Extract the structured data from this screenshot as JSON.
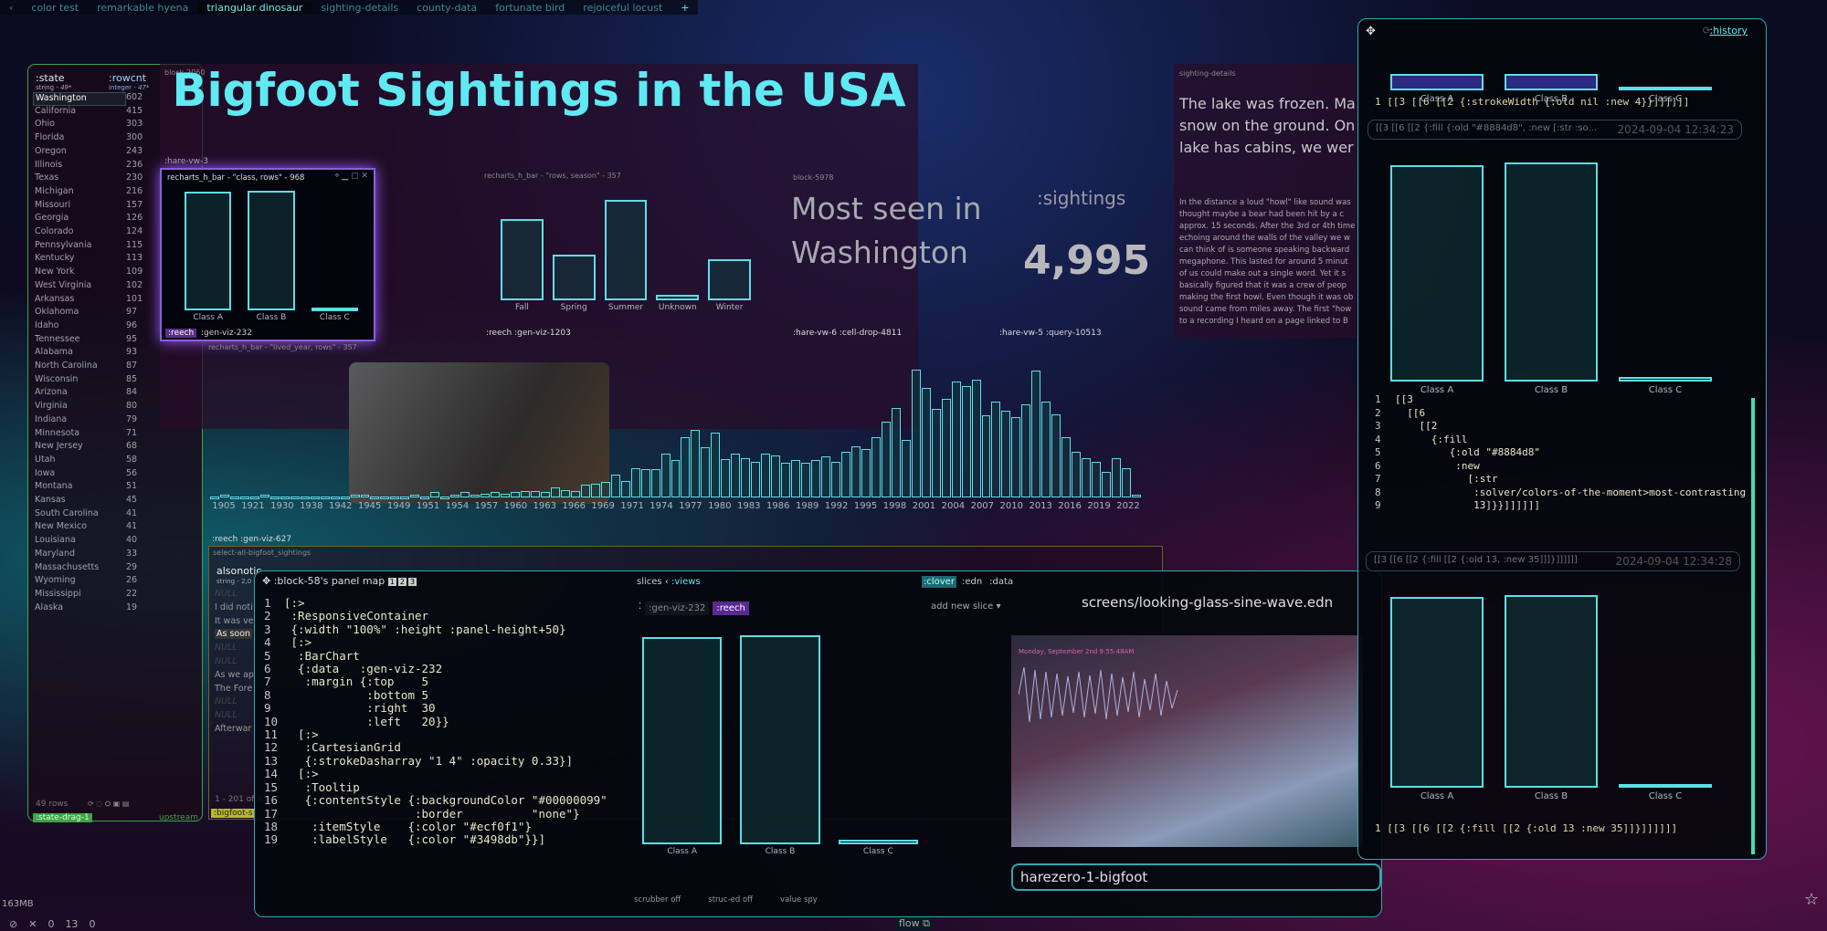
{
  "tabs": {
    "back": "‹",
    "items": [
      "color test",
      "remarkable hyena",
      "triangular dinosaur",
      "sighting-details",
      "county-data",
      "fortunate bird",
      "rejoiceful locust"
    ],
    "active": 2,
    "add": "+"
  },
  "state_table": {
    "columns": [
      {
        "name": ":state",
        "type": "string - ",
        "count": "49*"
      },
      {
        "name": ":rowcnt",
        "type": "integer - ",
        "count": "47*"
      }
    ],
    "rows": [
      [
        "Washington",
        "602"
      ],
      [
        "California",
        "415"
      ],
      [
        "Ohio",
        "303"
      ],
      [
        "Florida",
        "300"
      ],
      [
        "Oregon",
        "243"
      ],
      [
        "Illinois",
        "236"
      ],
      [
        "Texas",
        "230"
      ],
      [
        "Michigan",
        "216"
      ],
      [
        "Missouri",
        "157"
      ],
      [
        "Georgia",
        "126"
      ],
      [
        "Colorado",
        "124"
      ],
      [
        "Pennsylvania",
        "115"
      ],
      [
        "Kentucky",
        "113"
      ],
      [
        "New York",
        "109"
      ],
      [
        "West Virginia",
        "102"
      ],
      [
        "Arkansas",
        "101"
      ],
      [
        "Oklahoma",
        "97"
      ],
      [
        "Idaho",
        "96"
      ],
      [
        "Tennessee",
        "95"
      ],
      [
        "Alabama",
        "93"
      ],
      [
        "North Carolina",
        "87"
      ],
      [
        "Wisconsin",
        "85"
      ],
      [
        "Arizona",
        "84"
      ],
      [
        "Virginia",
        "80"
      ],
      [
        "Indiana",
        "79"
      ],
      [
        "Minnesota",
        "71"
      ],
      [
        "New Jersey",
        "68"
      ],
      [
        "Utah",
        "58"
      ],
      [
        "Iowa",
        "56"
      ],
      [
        "Montana",
        "51"
      ],
      [
        "Kansas",
        "45"
      ],
      [
        "South Carolina",
        "41"
      ],
      [
        "New Mexico",
        "41"
      ],
      [
        "Louisiana",
        "40"
      ],
      [
        "Maryland",
        "33"
      ],
      [
        "Massachusetts",
        "29"
      ],
      [
        "Wyoming",
        "26"
      ],
      [
        "Mississippi",
        "22"
      ],
      [
        "Alaska",
        "19"
      ]
    ],
    "selected": 0,
    "footer": "49 rows",
    "tag": ":state-drag-1",
    "upstream": "upstream"
  },
  "dashboard": {
    "block": "block-2060",
    "title": "Bigfoot Sightings in the USA",
    "hare3": ":hare-vw-3",
    "class_window": {
      "title": "recharts_h_bar - \"class, rows\" - 968",
      "tag1": ":reech",
      "tag2": ":gen-viz-232"
    },
    "season_label": "recharts_h_bar - \"rows, season\" - 357",
    "season_tag1": ":reech",
    "season_tag2": ":gen-viz-1203",
    "block5978": "block-5978",
    "most_seen": "Most seen in Washington",
    "sightings_label": ":sightings",
    "sightings_value": "4,995",
    "hare6": ":hare-vw-6",
    "cell_drop": ":cell-drop-4811",
    "hare5": ":hare-vw-5",
    "query": ":query-10513",
    "hist_label": "recharts_h_bar - \"lived_year, rows\" - 357",
    "hist_tag1": ":reech",
    "hist_tag2": ":gen-viz-627"
  },
  "details": {
    "label": "sighting-details",
    "headline": "The lake was frozen. Ma\nsnow on the ground. On\nlake has cabins, we wer",
    "body": "In the distance a loud \"howl\" like sound was\nthought maybe a bear had been hit by a c\napprox. 15 seconds. After the 3rd or 4th time\nechoing around the walls of the valley we w\ncan think of is someone speaking backward\nmegaphone. This lasted for around 5 minut\nof us could make out a single word. Yet it s\nbasically figured that it was a crew of peop\nmaking the first howl. Even though it was ob\nsound came from miles away. The first \"how\nto a recording I heard on a page linked to B"
  },
  "sightings_table": {
    "label": "select-all-bigfoot_sightings",
    "column": "alsonotic",
    "type": "string - 2,0",
    "rows": [
      "NULL",
      "I did noti",
      "It was ve",
      "As soon",
      "NULL",
      "NULL",
      "As we ap",
      "The Fore",
      "NULL",
      "NULL",
      "Afterwar"
    ],
    "selected": 3,
    "footer": "1 - 201 of 4",
    "tag": ":bigfoot-s"
  },
  "chart_data": [
    {
      "type": "bar",
      "title": "recharts_h_bar - \"class, rows\" - 968",
      "categories": [
        "Class A",
        "Class B",
        "Class C"
      ],
      "values": [
        87,
        88,
        2
      ]
    },
    {
      "type": "bar",
      "title": "recharts_h_bar - \"rows, season\" - 357",
      "categories": [
        "Fall",
        "Spring",
        "Summer",
        "Unknown",
        "Winter"
      ],
      "values": [
        69,
        39,
        85,
        5,
        35
      ]
    },
    {
      "type": "bar",
      "title": "recharts_h_bar - \"lived_year, rows\" - 357",
      "tick_labels": [
        "1905",
        "1921",
        "1930",
        "1938",
        "1942",
        "1945",
        "1949",
        "1951",
        "1954",
        "1957",
        "1960",
        "1963",
        "1966",
        "1969",
        "1971",
        "1974",
        "1977",
        "1980",
        "1983",
        "1986",
        "1989",
        "1992",
        "1995",
        "1998",
        "2001",
        "2004",
        "2007",
        "2010",
        "2013",
        "2016",
        "2019",
        "2022"
      ],
      "values": [
        1,
        2,
        1,
        1,
        1,
        2,
        1,
        1,
        1,
        1,
        1,
        1,
        1,
        1,
        2,
        2,
        1,
        1,
        1,
        1,
        2,
        1,
        4,
        1,
        2,
        4,
        2,
        3,
        4,
        3,
        4,
        5,
        5,
        4,
        8,
        6,
        5,
        10,
        11,
        12,
        18,
        13,
        23,
        22,
        22,
        34,
        29,
        47,
        53,
        39,
        51,
        30,
        34,
        31,
        28,
        34,
        33,
        27,
        29,
        27,
        29,
        32,
        28,
        36,
        40,
        38,
        47,
        59,
        70,
        45,
        100,
        86,
        69,
        77,
        91,
        87,
        92,
        64,
        75,
        68,
        63,
        73,
        99,
        75,
        65,
        47,
        36,
        31,
        28,
        20,
        31,
        23,
        2
      ]
    },
    {
      "type": "bar",
      "categories": [
        "Class A",
        "Class B",
        "Class C"
      ],
      "values": [
        95,
        96,
        2
      ]
    }
  ],
  "panel_map": {
    "title": ":block-58's panel map",
    "badges": [
      "1",
      "2",
      "3"
    ],
    "lines": [
      "[:>",
      " :ResponsiveContainer",
      " {:width \"100%\" :height :panel-height+50}",
      " [:>",
      "  :BarChart",
      "  {:data   :gen-viz-232",
      "   :margin {:top    5",
      "            :bottom 5",
      "            :right  30",
      "            :left   20}}",
      "  [:>",
      "   :CartesianGrid",
      "   {:strokeDasharray \"1 4\" :opacity 0.33}]",
      "  [:>",
      "   :Tooltip",
      "   {:contentStyle {:backgroundColor \"#00000099\"",
      "                   :border          \"none\"}",
      "    :itemStyle    {:color \"#ecf0f1\"}",
      "    :labelStyle   {:color \"#3498db\"}}]"
    ]
  },
  "slices": {
    "label": "slices",
    "back": "‹",
    "views": ":views",
    "modes": [
      ":clover",
      ":edn",
      ":data"
    ],
    "chip1": ":gen-viz-232",
    "chip2": ":reech",
    "add": "add new slice",
    "add_caret": "▾",
    "footer": [
      "scrubber off",
      "struc-ed off",
      "value spy"
    ]
  },
  "screen": {
    "file": "screens/looking-glass-sine-wave.edn",
    "caption": "Monday, September 2nd 9:55:48AM",
    "input": "harezero-1-bigfoot"
  },
  "history": {
    "link": ":history",
    "top_line": "1 [[3 [[6 [[2 {:strokeWidth {:old nil :new 4}}]]]]]]",
    "entry1": {
      "summary": "[[3 [[6 [[2 {:fill {:old \"#8884d8\", :new [:str :so...",
      "time": "2024-09-04 12:34:23"
    },
    "code": [
      "[[3",
      "  [[6",
      "    [[2",
      "      {:fill",
      "         {:old \"#8884d8\"",
      "          :new",
      "            [:str",
      "             :solver/colors-of-the-moment>most-contrasting",
      "             13]}}]]]]]]"
    ],
    "entry2": {
      "summary": "[[3 [[6 [[2 {:fill [[2 {:old 13, :new 35]]]}]]]]]]",
      "time": "2024-09-04 12:34:28"
    },
    "bottom_line": "1 [[3 [[6 [[2 {:fill [[2 {:old 13 :new 35]]}]]]]]]",
    "cats": [
      "Class A",
      "Class B",
      "Class C"
    ]
  },
  "status": {
    "memory": "163MB",
    "counts": [
      "0",
      "13",
      "0"
    ],
    "flow": "flow"
  },
  "colors": {
    "accent": "#5fe9f3",
    "purple": "#8a5de0",
    "green": "#3fa34a",
    "old_fill": "#8884d8"
  }
}
